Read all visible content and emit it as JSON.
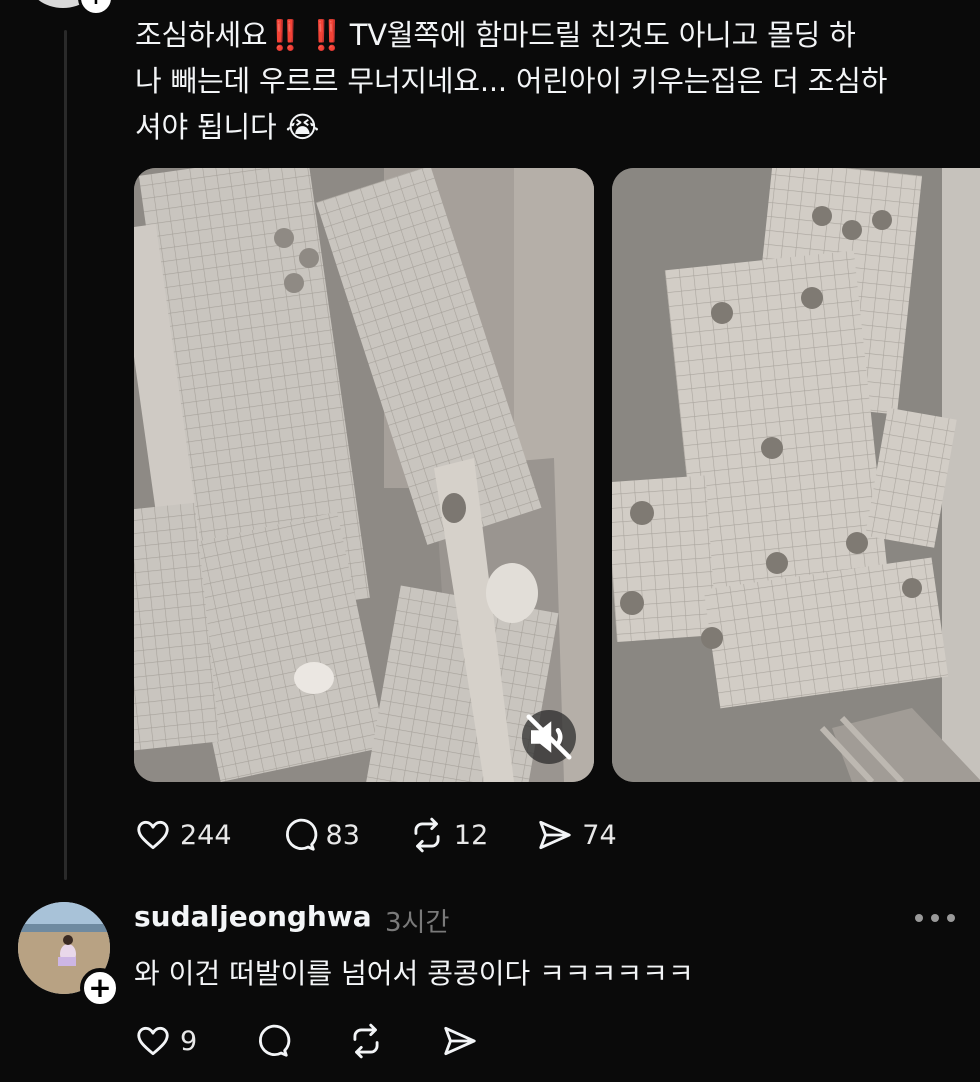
{
  "post": {
    "text_lines": [
      "TV월쪽에 함마드릴 친것도 아니고 몰딩 하",
      "나 빼는데 우르르 무너지네요... 어린아이 키우는집은 더 조심하",
      "셔야 됩니다"
    ],
    "text_prefix": "조심하세요",
    "bang_glyphs": [
      "‼️",
      "‼️"
    ],
    "emoji": "😭",
    "likes": "244",
    "comments": "83",
    "reposts": "12",
    "shares": "74"
  },
  "reply": {
    "username": "sudaljeonghwa",
    "time": "3시간",
    "text": "와 이건 떠발이를 넘어서 콩콩이다 ㅋㅋㅋㅋㅋㅋ",
    "likes": "9"
  },
  "colors": {
    "background": "#0a0a0a",
    "text": "#f3f5f7",
    "muted": "#7a7a7a",
    "bang": "#ff2d2d"
  },
  "icons": [
    "plus-icon",
    "mute-icon",
    "heart-icon",
    "comment-icon",
    "repost-icon",
    "share-icon",
    "more-icon"
  ]
}
